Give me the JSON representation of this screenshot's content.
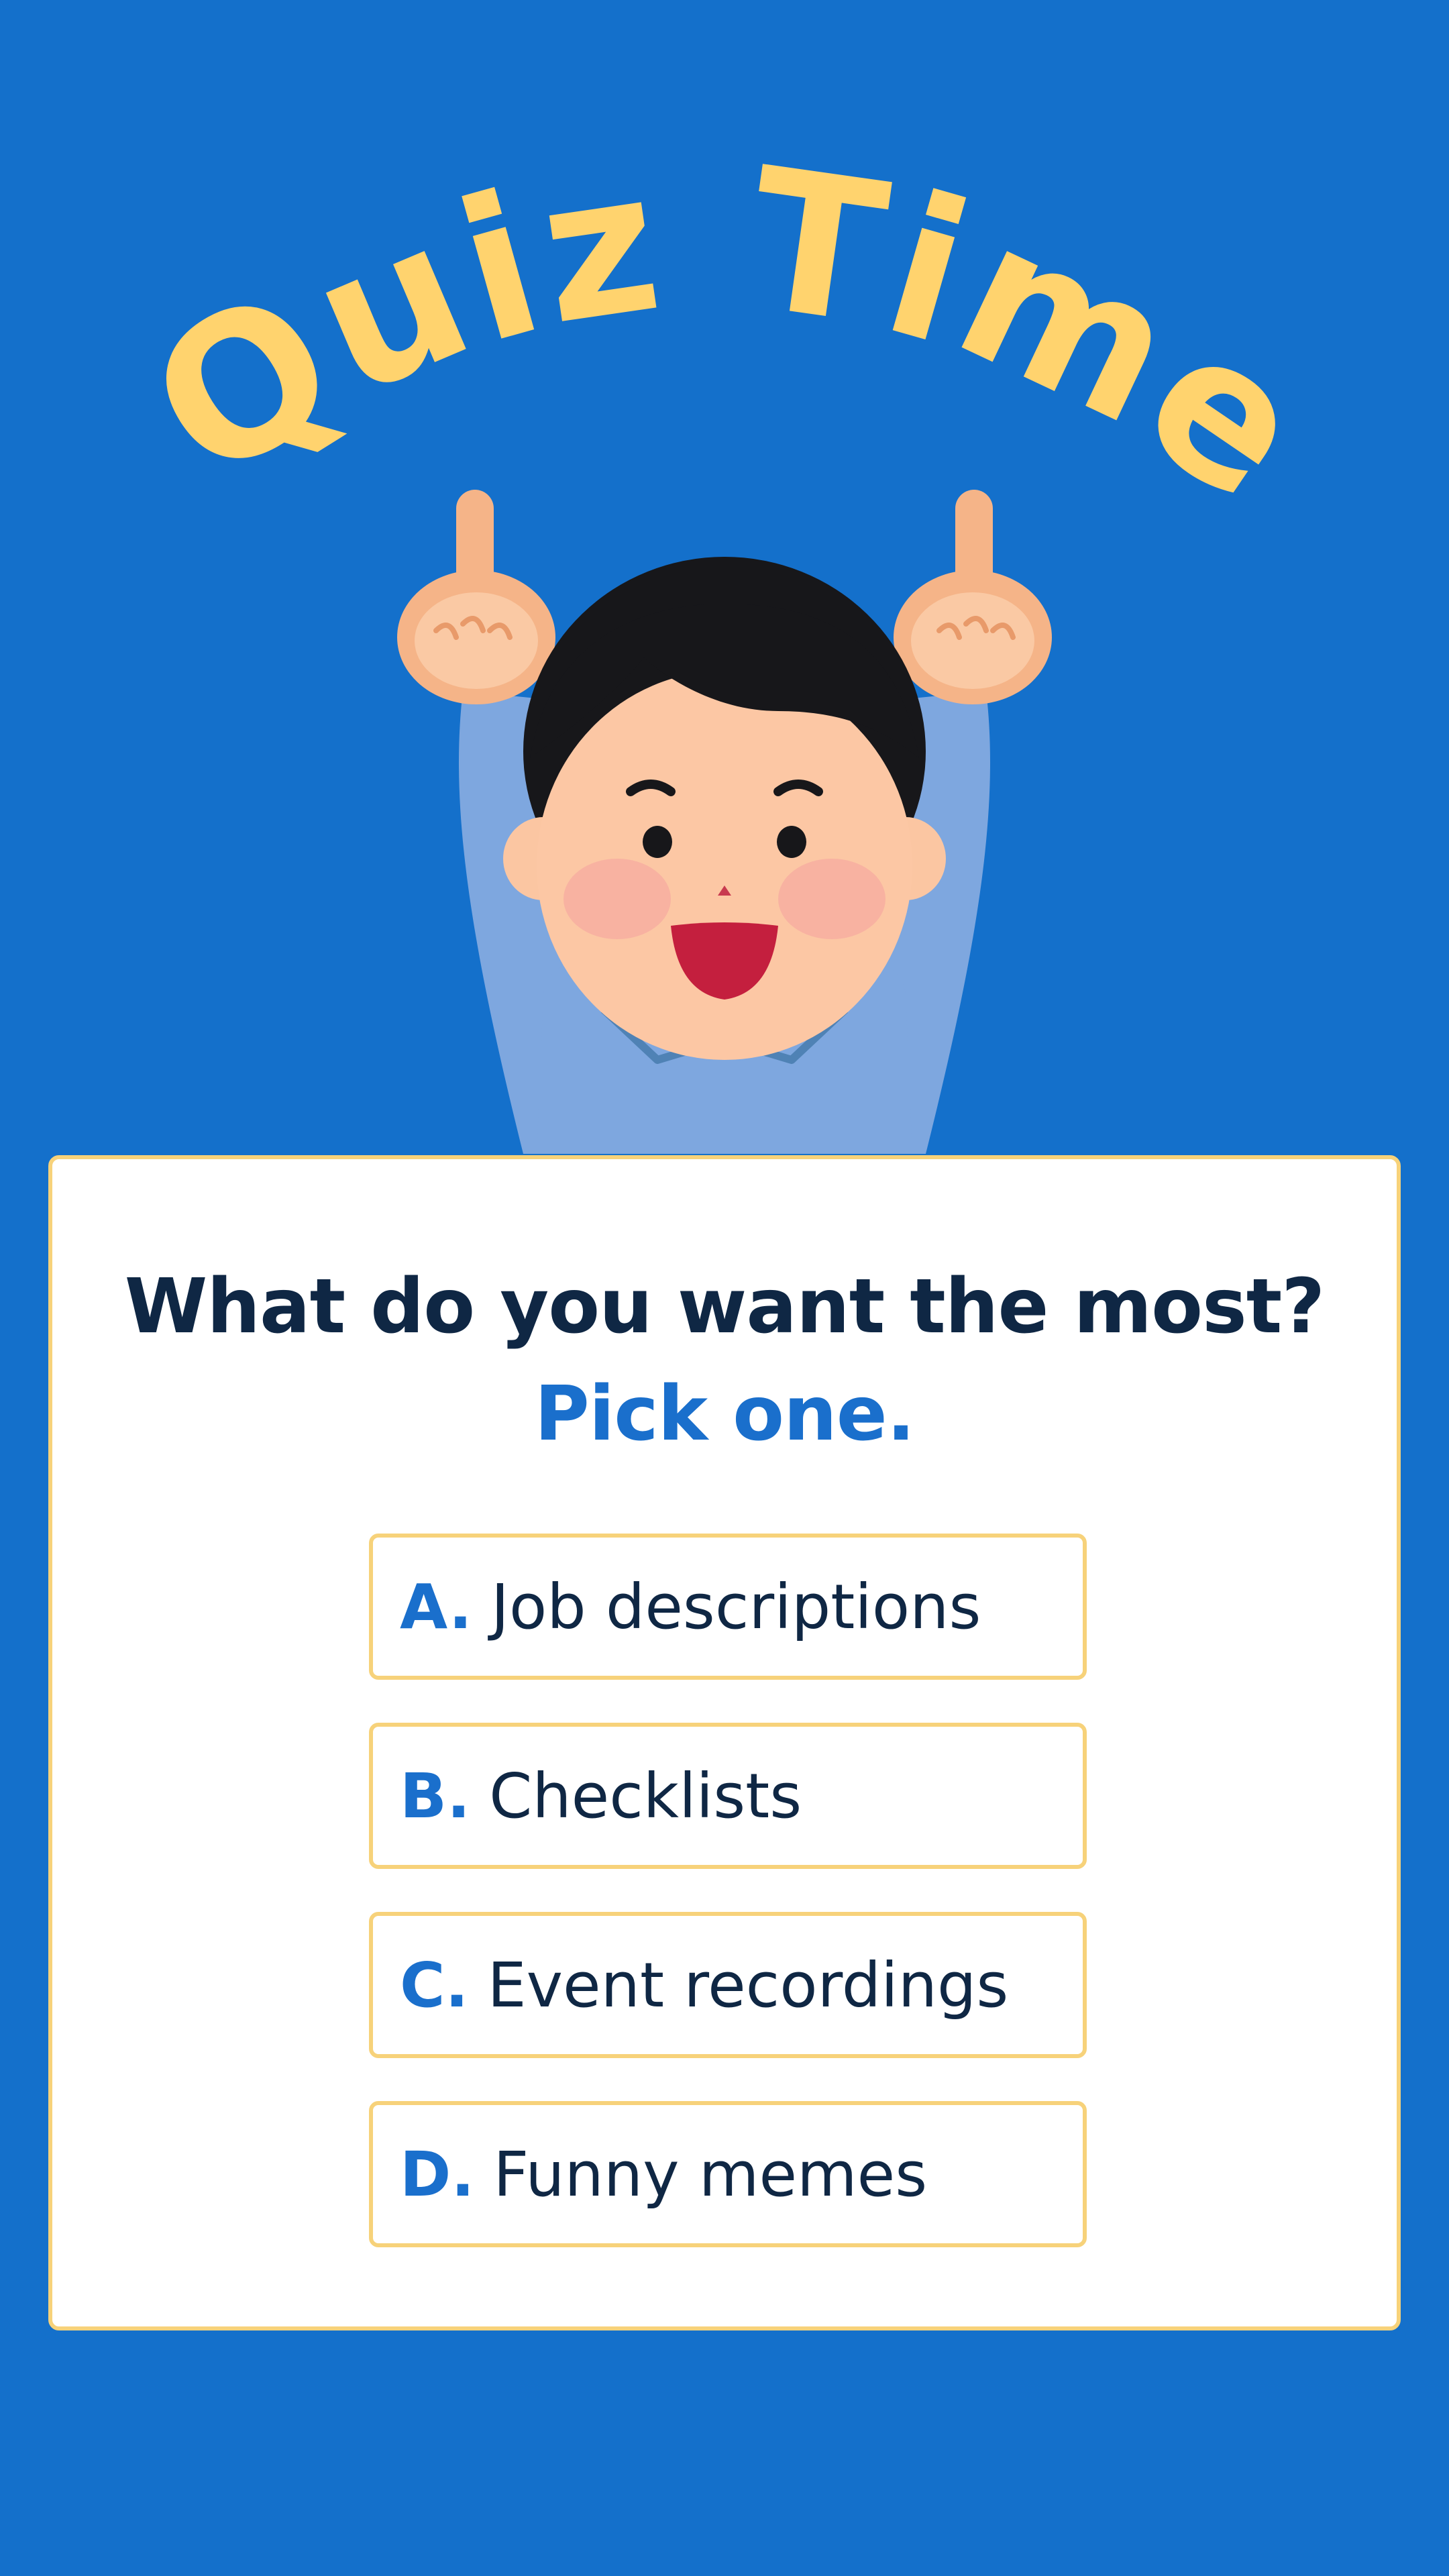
{
  "title": "Quiz Time",
  "question": "What do you want the most?",
  "instruction": "Pick one.",
  "options": [
    {
      "letter": "A.",
      "label": "Job descriptions"
    },
    {
      "letter": "B.",
      "label": "Checklists"
    },
    {
      "letter": "C.",
      "label": "Event recordings"
    },
    {
      "letter": "D.",
      "label": "Funny memes"
    }
  ],
  "colors": {
    "background": "#1470cb",
    "title": "#ffd36e",
    "question_text": "#0f2744",
    "accent": "#1a6fcc",
    "option_border": "#f7d27a",
    "card": "#ffffff"
  },
  "illustration": {
    "subject": "boy pointing up with both hands",
    "icon": "pointing-boy-illustration"
  }
}
